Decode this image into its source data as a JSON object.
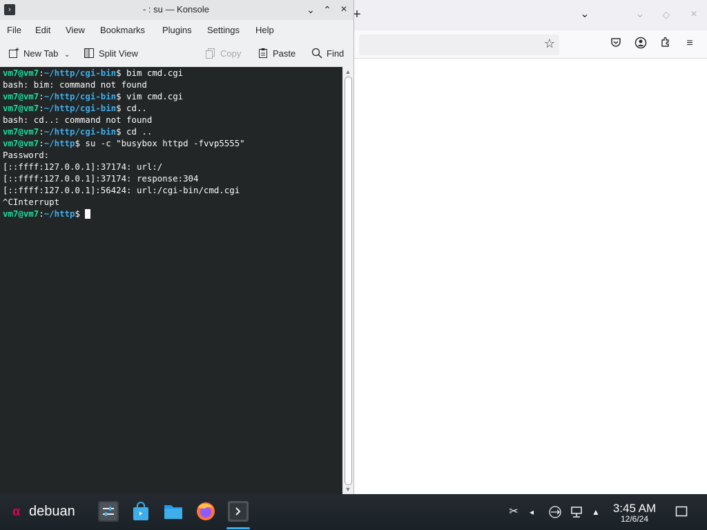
{
  "browser": {
    "tab_buttons": [
      "new-tab",
      "list-all-tabs",
      "minimize",
      "maximize",
      "close"
    ],
    "toolbar_icons": [
      "bookmark-star-icon",
      "pocket-icon",
      "account-icon",
      "extensions-icon",
      "menu-icon"
    ]
  },
  "konsole": {
    "title": "- : su — Konsole",
    "menu": [
      "File",
      "Edit",
      "View",
      "Bookmarks",
      "Plugins",
      "Settings",
      "Help"
    ],
    "toolbar": {
      "new_tab": "New Tab",
      "split_view": "Split View",
      "copy": "Copy",
      "paste": "Paste",
      "find": "Find"
    },
    "terminal_lines": [
      {
        "user": "vm7@vm7",
        "path": "~/http/cgi-bin",
        "cmd": " bim cmd.cgi"
      },
      {
        "text": "bash: bim: command not found"
      },
      {
        "user": "vm7@vm7",
        "path": "~/http/cgi-bin",
        "cmd": " vim cmd.cgi"
      },
      {
        "user": "vm7@vm7",
        "path": "~/http/cgi-bin",
        "cmd": " cd.."
      },
      {
        "text": "bash: cd..: command not found"
      },
      {
        "user": "vm7@vm7",
        "path": "~/http/cgi-bin",
        "cmd": " cd .."
      },
      {
        "user": "vm7@vm7",
        "path": "~/http",
        "cmd": " su -c \"busybox httpd -fvvp5555\""
      },
      {
        "text": "Password:"
      },
      {
        "text": "[::ffff:127.0.0.1]:37174: url:/"
      },
      {
        "text": "[::ffff:127.0.0.1]:37174: response:304"
      },
      {
        "text": "[::ffff:127.0.0.1]:56424: url:/cgi-bin/cmd.cgi"
      },
      {
        "text": "^CInterrupt"
      },
      {
        "user": "vm7@vm7",
        "path": "~/http",
        "cmd": " ",
        "cursor": true
      }
    ]
  },
  "taskbar": {
    "launcher_label": "debuan",
    "tasks": [
      "system-settings",
      "discover-store",
      "file-manager",
      "firefox",
      "konsole"
    ],
    "tray": [
      "clipboard-icon",
      "volume-icon",
      "usb-icon",
      "network-icon",
      "tray-expand-icon"
    ],
    "time": "3:45 AM",
    "date": "12/6/24"
  },
  "colors": {
    "terminal_bg": "#232627",
    "prompt_user": "#1cdc9a",
    "prompt_path": "#3daee9",
    "taskbar_bg": "#1f252a"
  }
}
